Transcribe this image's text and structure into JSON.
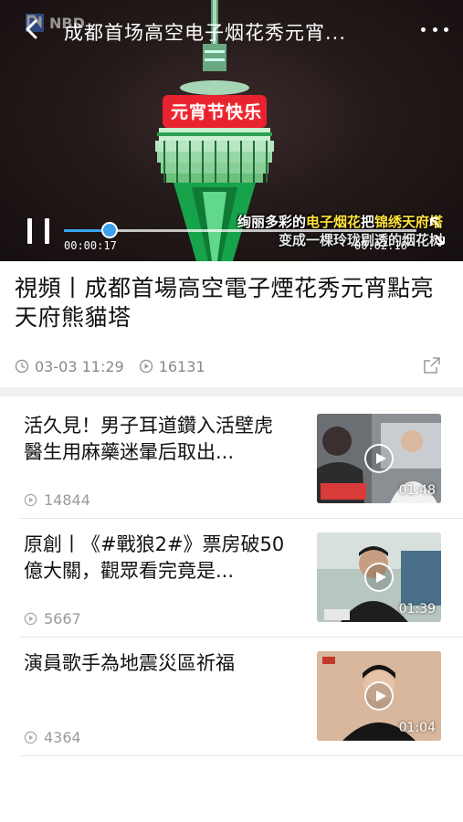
{
  "player": {
    "title": "成都首场高空电子烟花秀元宵...",
    "sign_text": "元宵节快乐",
    "subtitle_line1_a": "绚丽多彩的",
    "subtitle_line1_b": "电子烟花",
    "subtitle_line1_c": "把",
    "subtitle_line1_d": "锦绣天府塔",
    "subtitle_line2": "变成一棵玲珑剔透的烟花树",
    "current_time": "00:00:17",
    "total_time": "00:02:16",
    "progress": 0.13,
    "accent_color": "#3aa2f0",
    "icons": {
      "back": "chevron-left-icon",
      "more": "more-dots-icon",
      "pause": "pause-icon",
      "fullscreen": "fullscreen-icon"
    }
  },
  "article": {
    "title": "視頻丨成都首場高空電子煙花秀元宵點亮天府熊貓塔",
    "date": "03-03 11:29",
    "views": "16131"
  },
  "related": [
    {
      "title": "活久見！男子耳道鑽入活壁虎 醫生用麻藥迷暈后取出...",
      "views": "14844",
      "duration": "01:48"
    },
    {
      "title": "原創丨《#戰狼2#》票房破50億大關，觀眾看完竟是...",
      "views": "5667",
      "duration": "01:39"
    },
    {
      "title": "演員歌手為地震災區祈福",
      "views": "4364",
      "duration": "01:04"
    }
  ]
}
